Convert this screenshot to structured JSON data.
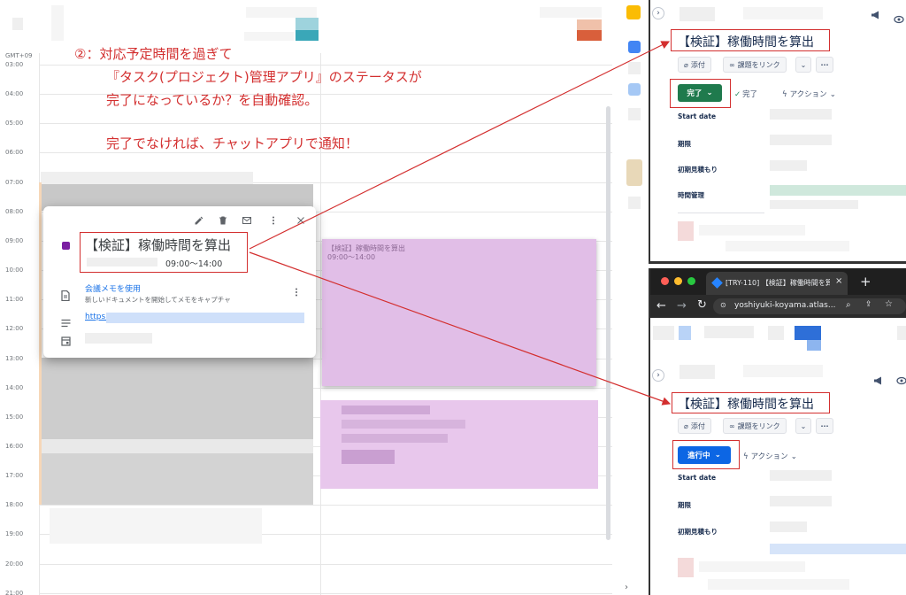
{
  "annotation": {
    "line1": "②：対応予定時間を過ぎて",
    "line2": "『タスク(プロジェクト)管理アプリ』のステータスが",
    "line3": "完了になっているか？を自動確認。",
    "line4": "完了でなければ、チャットアプリで通知！"
  },
  "calendar": {
    "timezone": "GMT+09",
    "hours": [
      "03:00",
      "04:00",
      "05:00",
      "06:00",
      "07:00",
      "08:00",
      "09:00",
      "10:00",
      "11:00",
      "12:00",
      "13:00",
      "14:00",
      "15:00",
      "16:00",
      "17:00",
      "18:00",
      "19:00",
      "20:00",
      "21:00"
    ],
    "event": {
      "title": "【検証】稼働時間を算出",
      "time": "09:00〜14:00",
      "block_title": "【検証】稼働時間を算出",
      "block_time": "09:00〜14:00"
    },
    "popup": {
      "meeting_notes_title": "会議メモを使用",
      "meeting_notes_desc": "新しいドキュメントを開始してメモをキャプチャ",
      "link_text": "https:"
    }
  },
  "jira_done": {
    "title": "【検証】稼働時間を算出",
    "attach_label": "添付",
    "link_issue_label": "課題をリンク",
    "status_label": "完了",
    "resolution_label": "完了",
    "action_label": "アクション",
    "fields": [
      "Start date",
      "期限",
      "初期見積もり",
      "時間管理"
    ]
  },
  "browser": {
    "tab_title": "[TRY-110] 【検証】稼働時間を算",
    "url": "yoshiyuki-koyama.atlas..."
  },
  "jira_inprogress": {
    "title": "【検証】稼働時間を算出",
    "attach_label": "添付",
    "link_issue_label": "課題をリンク",
    "status_label": "進行中",
    "action_label": "アクション",
    "fields": [
      "Start date",
      "期限",
      "初期見積もり"
    ]
  },
  "colors": {
    "annotation_red": "#d32f2f",
    "done_green": "#1f7a4d",
    "inprogress_blue": "#0c66e4",
    "event_purple": "#e1bee7"
  }
}
